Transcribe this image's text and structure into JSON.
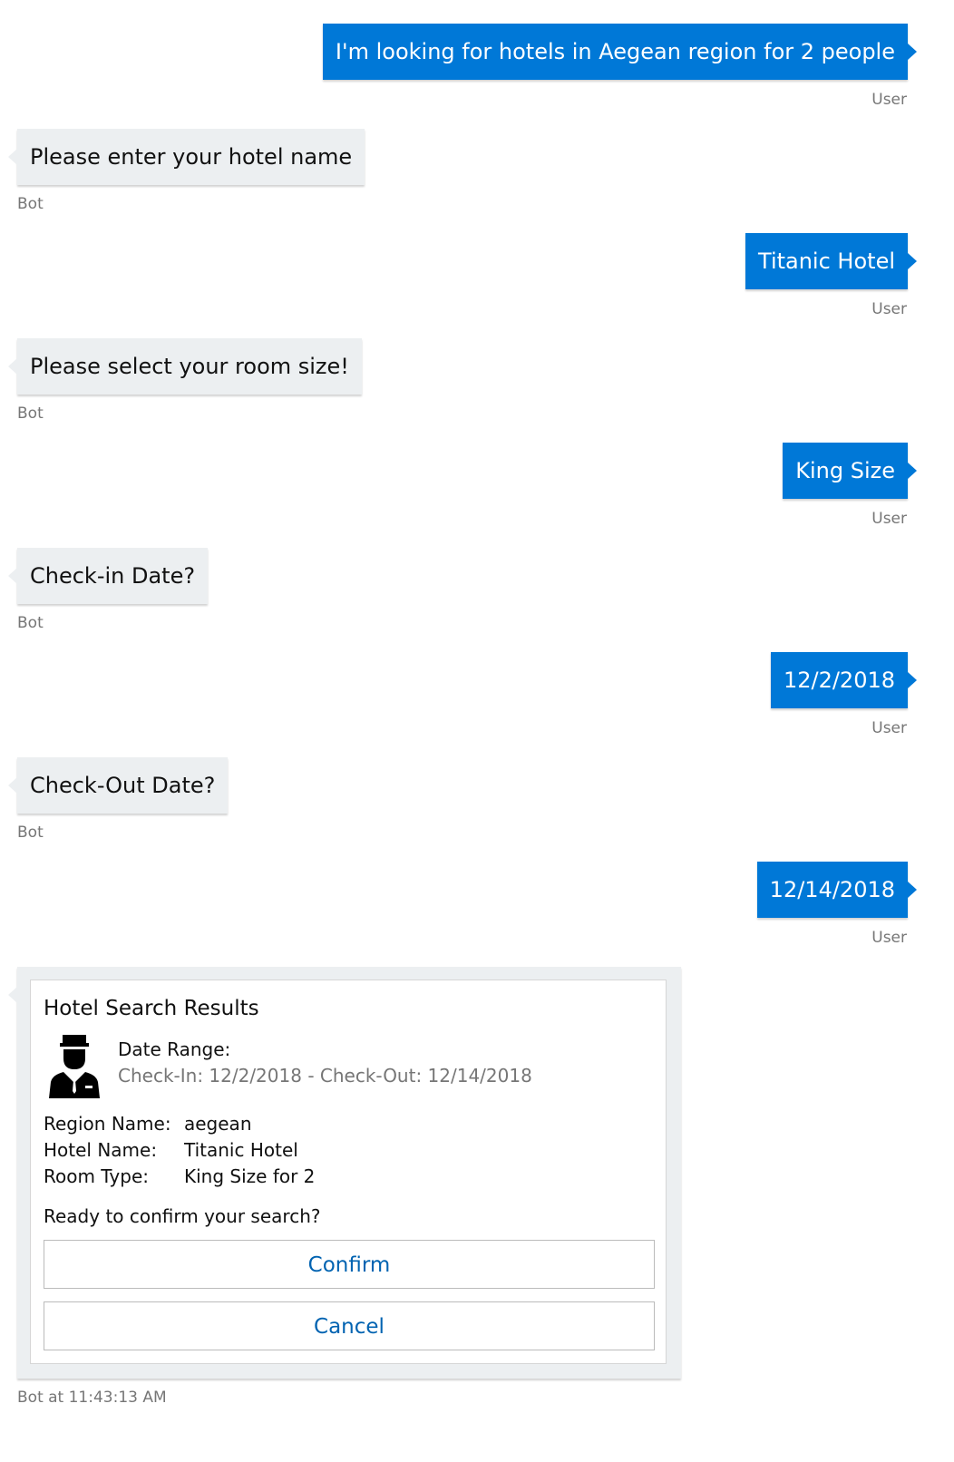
{
  "messages": [
    {
      "from": "user",
      "text": "I'm looking for hotels in Aegean region for 2 people",
      "meta": "User"
    },
    {
      "from": "bot",
      "text": "Please enter your hotel name",
      "meta": "Bot"
    },
    {
      "from": "user",
      "text": "Titanic Hotel",
      "meta": "User"
    },
    {
      "from": "bot",
      "text": "Please select your room size!",
      "meta": "Bot"
    },
    {
      "from": "user",
      "text": "King Size",
      "meta": "User"
    },
    {
      "from": "bot",
      "text": "Check-in Date?",
      "meta": "Bot"
    },
    {
      "from": "user",
      "text": "12/2/2018",
      "meta": "User"
    },
    {
      "from": "bot",
      "text": "Check-Out Date?",
      "meta": "Bot"
    },
    {
      "from": "user",
      "text": "12/14/2018",
      "meta": "User"
    }
  ],
  "card": {
    "title": "Hotel Search Results",
    "avatar_icon": "concierge-icon",
    "date_label": "Date Range:",
    "date_value": "Check-In: 12/2/2018 - Check-Out: 12/14/2018",
    "facts": [
      {
        "key": "Region Name:",
        "value": "aegean"
      },
      {
        "key": "Hotel Name:",
        "value": "Titanic Hotel"
      },
      {
        "key": "Room Type:",
        "value": "King Size for 2"
      }
    ],
    "question": "Ready to confirm your search?",
    "confirm_label": "Confirm",
    "cancel_label": "Cancel",
    "meta": "Bot at 11:43:13 AM"
  },
  "colors": {
    "user_bubble": "#0078d7",
    "bot_bubble": "#eceff1",
    "action_text": "#0063b1"
  }
}
